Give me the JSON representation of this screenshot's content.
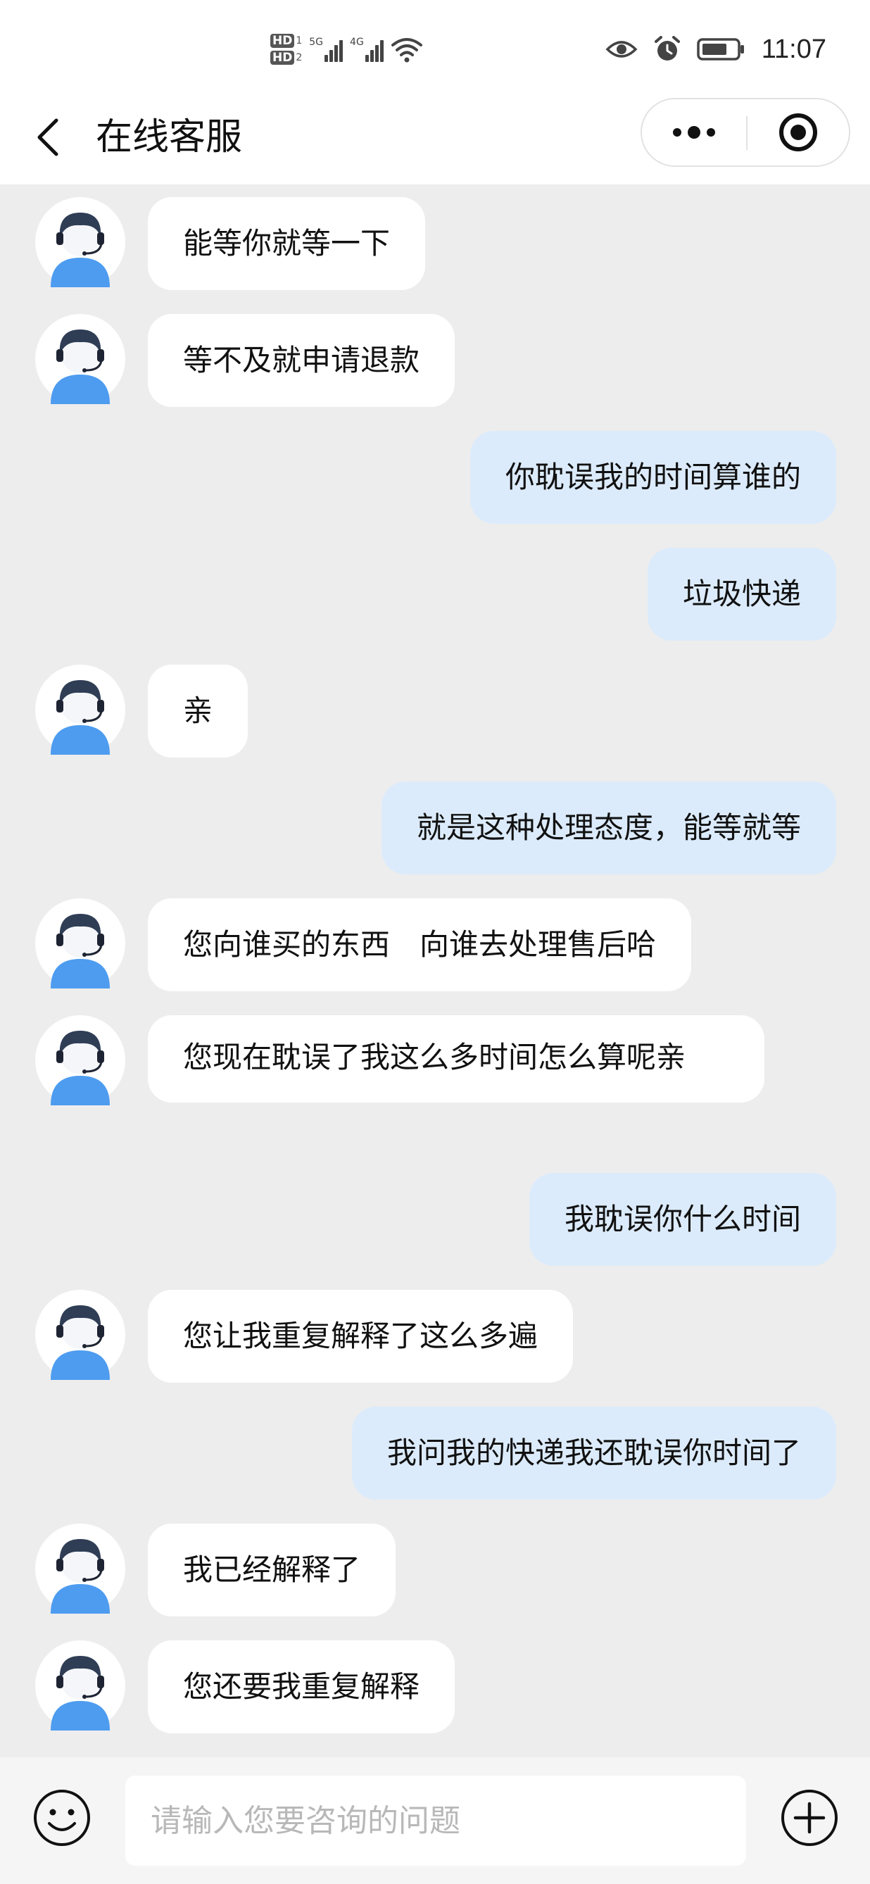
{
  "status_bar": {
    "time": "11:07",
    "hd1": "HD",
    "hd1_num": "1",
    "hd2": "HD",
    "hd2_num": "2",
    "net1": "5G",
    "net2": "4G"
  },
  "nav": {
    "title": "在线客服"
  },
  "messages": [
    {
      "side": "left",
      "text": "能等你就等一下"
    },
    {
      "side": "left",
      "text": "等不及就申请退款"
    },
    {
      "side": "right",
      "text": "你耽误我的时间算谁的"
    },
    {
      "side": "right",
      "text": "垃圾快递"
    },
    {
      "side": "left",
      "text": "亲"
    },
    {
      "side": "right",
      "text": "就是这种处理态度，能等就等"
    },
    {
      "side": "left",
      "text": "您向谁买的东西　向谁去处理售后哈"
    },
    {
      "side": "left",
      "text": "您现在耽误了我这么多时间怎么算呢亲"
    },
    {
      "side": "right",
      "text": "我耽误你什么时间"
    },
    {
      "side": "left",
      "text": "您让我重复解释了这么多遍"
    },
    {
      "side": "right",
      "text": "我问我的快递我还耽误你时间了"
    },
    {
      "side": "left",
      "text": "我已经解释了"
    },
    {
      "side": "left",
      "text": "您还要我重复解释"
    }
  ],
  "input": {
    "placeholder": "请输入您要咨询的问题"
  },
  "icons": {
    "back": "chevron-left-icon",
    "more": "more-dots-icon",
    "close": "target-circle-icon",
    "emoji": "emoji-icon",
    "plus": "plus-circle-icon",
    "avatar": "agent-headset-avatar"
  },
  "colors": {
    "page_bg": "#ededed",
    "bubble_agent": "#ffffff",
    "bubble_user": "#dcebfb",
    "avatar_body": "#4d9cf0"
  }
}
